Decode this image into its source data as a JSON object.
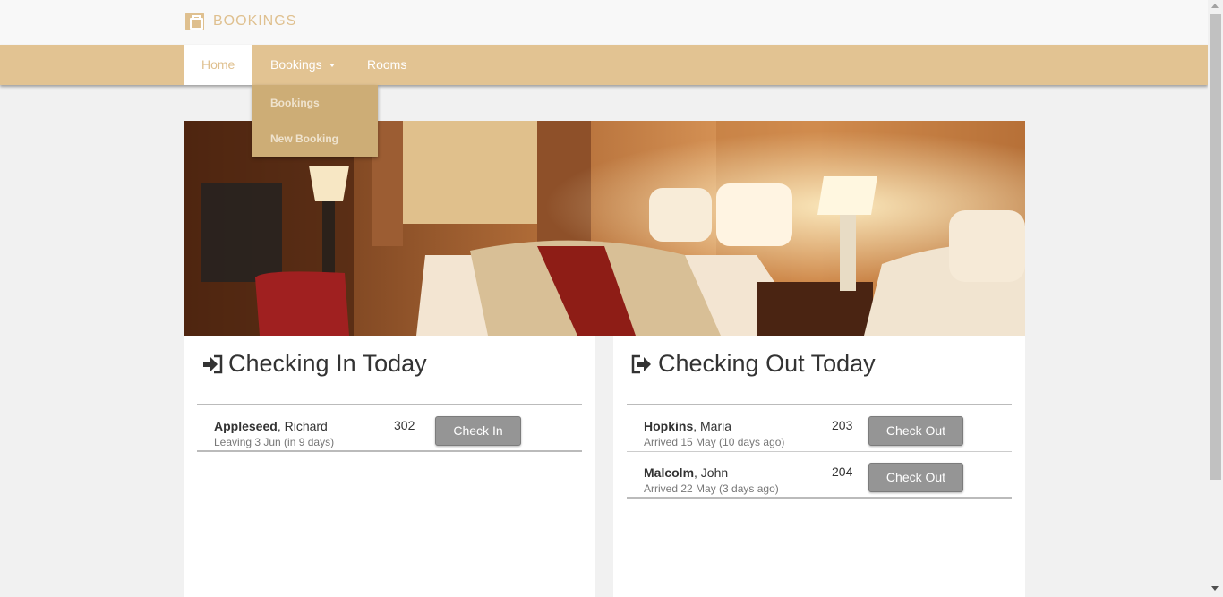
{
  "brand": {
    "title": "BOOKINGS",
    "icon": "briefcase-icon"
  },
  "nav": {
    "home": "Home",
    "bookings": "Bookings",
    "rooms": "Rooms",
    "dropdown": [
      "Bookings",
      "New Booking"
    ]
  },
  "hero": {
    "alt": "Hotel bedroom"
  },
  "checkin": {
    "title": "Checking In Today",
    "icon": "sign-in-icon",
    "rows": [
      {
        "last": "Appleseed",
        "first": ", Richard",
        "sub": "Leaving 3 Jun (in 9 days)",
        "room": "302",
        "button": "Check In"
      }
    ]
  },
  "checkout": {
    "title": "Checking Out Today",
    "icon": "sign-out-icon",
    "rows": [
      {
        "last": "Hopkins",
        "first": ", Maria",
        "sub": "Arrived 15 May (10 days ago)",
        "room": "203",
        "button": "Check Out"
      },
      {
        "last": "Malcolm",
        "first": ", John",
        "sub": "Arrived 22 May (3 days ago)",
        "room": "204",
        "button": "Check Out"
      }
    ]
  },
  "colors": {
    "accent": "#e2c392",
    "dropdown": "#cdad76",
    "button": "#959595"
  }
}
